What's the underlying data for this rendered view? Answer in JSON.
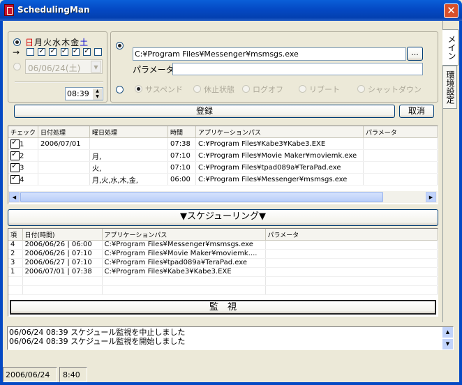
{
  "window": {
    "title": "SchedulingMan",
    "close_glyph": "✕"
  },
  "tabs": [
    {
      "label": "メイン"
    },
    {
      "label": "環境設定"
    }
  ],
  "days": {
    "labels": [
      "日",
      "月",
      "火",
      "水",
      "木",
      "金",
      "土"
    ],
    "checked": [
      false,
      true,
      true,
      true,
      true,
      true,
      false
    ],
    "arrow": "→",
    "colors": {
      "sunday": "#d40000",
      "saturday": "#0000d4"
    }
  },
  "date_picker": {
    "value": "06/06/24(土)"
  },
  "time": {
    "value": "08:39"
  },
  "app": {
    "path": "C:¥Program Files¥Messenger¥msmsgs.exe",
    "browse_label": "...",
    "param_label": "パラメータ",
    "param_value": ""
  },
  "power_options": [
    "サスペンド",
    "休止状態",
    "ログオフ",
    "リブート",
    "シャットダウン"
  ],
  "register_label": "登録",
  "cancel_label": "取消",
  "task_table": {
    "columns": [
      "チェック",
      "日付処理",
      "曜日処理",
      "時間",
      "アプリケーションパス",
      "パラメータ"
    ],
    "rows": [
      {
        "num": "1",
        "date": "2006/07/01",
        "dow": "",
        "time": "07:38",
        "path": "C:¥Program Files¥Kabe3¥Kabe3.EXE",
        "param": ""
      },
      {
        "num": "2",
        "date": "",
        "dow": "月,",
        "time": "07:10",
        "path": "C:¥Program Files¥Movie Maker¥moviemk.exe",
        "param": ""
      },
      {
        "num": "3",
        "date": "",
        "dow": "火,",
        "time": "07:10",
        "path": "C:¥Program Files¥tpad089a¥TeraPad.exe",
        "param": ""
      },
      {
        "num": "4",
        "date": "",
        "dow": "月,火,水,木,金,",
        "time": "06:00",
        "path": "C:¥Program Files¥Messenger¥msmsgs.exe",
        "param": ""
      }
    ]
  },
  "scheduling_label": "▼スケジューリング▼",
  "schedule_table": {
    "columns": [
      "項",
      "日付(時間)",
      "アプリケーションパス",
      "パラメータ"
    ],
    "rows": [
      {
        "num": "4",
        "datetime": "2006/06/26 | 06:00",
        "path": "C:¥Program Files¥Messenger¥msmsgs.exe",
        "param": ""
      },
      {
        "num": "2",
        "datetime": "2006/06/26 | 07:10",
        "path": "C:¥Program Files¥Movie Maker¥moviemk....",
        "param": ""
      },
      {
        "num": "3",
        "datetime": "2006/06/27 | 07:10",
        "path": "C:¥Program Files¥tpad089a¥TeraPad.exe",
        "param": ""
      },
      {
        "num": "1",
        "datetime": "2006/07/01 | 07:38",
        "path": "C:¥Program Files¥Kabe3¥Kabe3.EXE",
        "param": ""
      }
    ]
  },
  "monitor_label": "監　視",
  "log": [
    "06/06/24 08:39 スケジュール監視を中止しました",
    "06/06/24 08:39 スケジュール監視を開始しました"
  ],
  "status": {
    "date": "2006/06/24",
    "time": "8:40"
  }
}
